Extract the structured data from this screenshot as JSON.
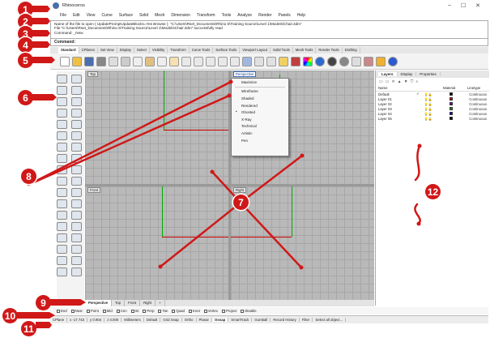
{
  "title": "Rhinoceros",
  "window_controls": [
    "–",
    "☐",
    "✕"
  ],
  "menu": [
    "File",
    "Edit",
    "View",
    "Curve",
    "Surface",
    "Solid",
    "Mesh",
    "Dimension",
    "Transform",
    "Tools",
    "Analyze",
    "Render",
    "Panels",
    "Help"
  ],
  "command_history": [
    "Name of the file to open ( UpdatePromptUpdateBlocks=Yes Browse ): \"C:\\Users\\Rset_Documents\\Rhino 5\\Training Source\\Level 1\\Models\\Chair.3dm\"",
    "File \"C:\\Users\\Rset_Documents\\Rhino 5\\Training Source\\Level 1\\Models\\Chair.3dm\" successfully read",
    "Command: _New"
  ],
  "command_prompt": "Command:",
  "toolbar_tabs": [
    "Standard",
    "CPlanes",
    "Set View",
    "Display",
    "Select",
    "Visibility",
    "Transform",
    "Curve Tools",
    "Surface Tools",
    "Solid Tools",
    "Mesh Tools",
    "Render Tools",
    "Drafting",
    "Viewport Layout"
  ],
  "viewports": {
    "top": "Top",
    "perspective": "Perspective",
    "front": "Front",
    "right": "Right"
  },
  "context_menu": {
    "items": [
      "Maximize",
      "Wireframe",
      "Shaded",
      "Rendered",
      "Ghosted",
      "X-Ray",
      "Technical",
      "Artistic",
      "Pen"
    ],
    "selected": "Ghosted"
  },
  "viewport_tabs": [
    "Perspective",
    "Top",
    "Front",
    "Right",
    "+"
  ],
  "panel": {
    "tabs": [
      "Layers",
      "Display",
      "Properties"
    ],
    "columns": [
      "Name",
      "Material",
      "Linetype"
    ],
    "layers": [
      {
        "name": "Default",
        "check": "✓",
        "color": "#000000",
        "linetype": "Continuous"
      },
      {
        "name": "Layer 01",
        "check": "",
        "color": "#cc0000",
        "linetype": "Continuous"
      },
      {
        "name": "Layer 02",
        "check": "",
        "color": "#6a00cc",
        "linetype": "Continuous"
      },
      {
        "name": "Layer 03",
        "check": "",
        "color": "#00a000",
        "linetype": "Continuous"
      },
      {
        "name": "Layer 04",
        "check": "",
        "color": "#0000cc",
        "linetype": "Continuous"
      },
      {
        "name": "Layer 05",
        "check": "",
        "color": "#000000",
        "linetype": "Continuous"
      }
    ]
  },
  "osnaps": [
    "End",
    "Near",
    "Point",
    "Mid",
    "Cen",
    "Int",
    "Perp",
    "Tan",
    "Quad",
    "Knot",
    "Vertex",
    "Project",
    "Disable"
  ],
  "status": [
    "CPlane",
    "x -17.743",
    "y 0.904",
    "z 0.000",
    "Millimeters",
    "Default",
    "Grid Snap",
    "Ortho",
    "Planar",
    "Osnap",
    "SmartTrack",
    "Gumball",
    "Record History",
    "Filter",
    "Select all object..."
  ],
  "status_on": "Osnap",
  "callouts": [
    "1",
    "2",
    "3",
    "4",
    "5",
    "6",
    "7",
    "8",
    "9",
    "10",
    "11",
    "12"
  ],
  "icons": {
    "logo": "rhino-logo-icon",
    "badge_color": "#d01818"
  }
}
